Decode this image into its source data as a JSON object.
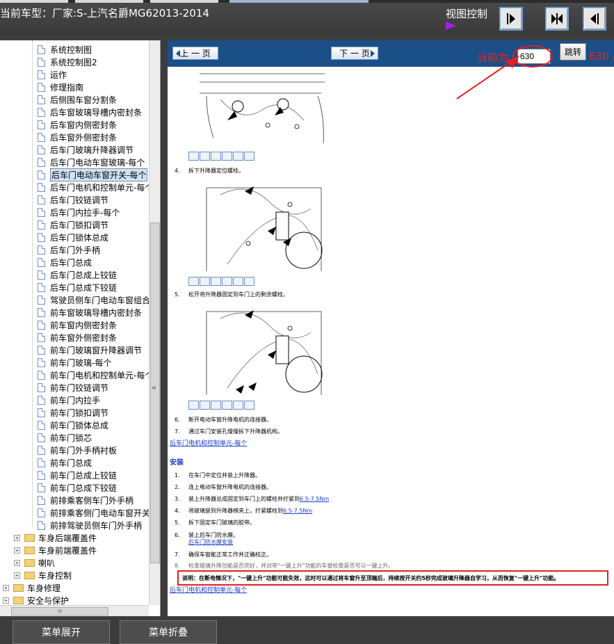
{
  "header": {
    "title": "当前车型：厂家:S-上汽名爵MG62013-2014",
    "view_control_label": "视图控制",
    "view_buttons": [
      "right-panel-toggle",
      "split-view-toggle",
      "left-panel-toggle"
    ]
  },
  "tree": {
    "items": [
      {
        "label": "系统控制图",
        "type": "doc"
      },
      {
        "label": "系统控制图2",
        "type": "doc"
      },
      {
        "label": "运作",
        "type": "doc"
      },
      {
        "label": "修理指南",
        "type": "doc"
      },
      {
        "label": "后侧围车窗分割条",
        "type": "doc"
      },
      {
        "label": "后车窗玻璃导槽内密封条",
        "type": "doc"
      },
      {
        "label": "后车窗内侧密封条",
        "type": "doc"
      },
      {
        "label": "后车窗外侧密封条",
        "type": "doc"
      },
      {
        "label": "后车门玻璃升降器调节",
        "type": "doc"
      },
      {
        "label": "后车门电动车窗玻璃-每个",
        "type": "doc"
      },
      {
        "label": "后车门电动车窗开关-每个",
        "type": "doc",
        "selected": true
      },
      {
        "label": "后车门电机和控制单元-每个",
        "type": "doc"
      },
      {
        "label": "后车门铰链调节",
        "type": "doc"
      },
      {
        "label": "后车门内拉手-每个",
        "type": "doc"
      },
      {
        "label": "后车门锁扣调节",
        "type": "doc"
      },
      {
        "label": "后车门锁体总成",
        "type": "doc"
      },
      {
        "label": "后车门外手柄",
        "type": "doc"
      },
      {
        "label": "后车门总成",
        "type": "doc"
      },
      {
        "label": "后车门总成上铰链",
        "type": "doc"
      },
      {
        "label": "后车门总成下铰链",
        "type": "doc"
      },
      {
        "label": "驾驶员侧车门电动车窗组合",
        "type": "doc"
      },
      {
        "label": "前车窗玻璃导槽内密封条",
        "type": "doc"
      },
      {
        "label": "前车窗内侧密封条",
        "type": "doc"
      },
      {
        "label": "前车窗外侧密封条",
        "type": "doc"
      },
      {
        "label": "前车门玻璃窗升降器调节",
        "type": "doc"
      },
      {
        "label": "前车门玻璃-每个",
        "type": "doc"
      },
      {
        "label": "前车门电机和控制单元-每个",
        "type": "doc"
      },
      {
        "label": "前车门铰链调节",
        "type": "doc"
      },
      {
        "label": "前车门内拉手",
        "type": "doc"
      },
      {
        "label": "前车门锁扣调节",
        "type": "doc"
      },
      {
        "label": "前车门锁体总成",
        "type": "doc"
      },
      {
        "label": "前车门锁芯",
        "type": "doc"
      },
      {
        "label": "前车门外手柄衬板",
        "type": "doc"
      },
      {
        "label": "前车门总成",
        "type": "doc"
      },
      {
        "label": "前车门总成上铰链",
        "type": "doc"
      },
      {
        "label": "前车门总成下铰链",
        "type": "doc"
      },
      {
        "label": "前排乘客侧车门外手柄",
        "type": "doc"
      },
      {
        "label": "前排乘客侧门电动车窗开关",
        "type": "doc"
      },
      {
        "label": "前排驾驶员侧车门外手柄",
        "type": "doc"
      },
      {
        "label": "车身后端覆盖件",
        "type": "folder",
        "level": 1
      },
      {
        "label": "车身前端覆盖件",
        "type": "folder",
        "level": 1
      },
      {
        "label": "喇叭",
        "type": "folder",
        "level": 1
      },
      {
        "label": "车身控制",
        "type": "folder",
        "level": 1
      },
      {
        "label": "车身修理",
        "type": "folder",
        "level": 0
      },
      {
        "label": "安全与保护",
        "type": "folder",
        "level": 0
      }
    ],
    "hscroll_grip": "III",
    "vscroll_grip": "≡"
  },
  "nav": {
    "prev_label": "上 一 页",
    "next_label": "下 一 页",
    "current_label": "当前为",
    "page_value": "630",
    "jump_label": "跳转",
    "total_text": "630 /"
  },
  "document": {
    "steps_a": [
      {
        "num": "4.",
        "text": "拆下升降器定位螺栓。"
      },
      {
        "num": "5.",
        "text": "松开将升降器固定到车门上的剩余螺栓。"
      },
      {
        "num": "6.",
        "text": "断开电动车窗升降电机的连接器。"
      },
      {
        "num": "7.",
        "text": "通过车门安装孔慢慢拆下升降器机构。"
      }
    ],
    "link_after_removal": "后车门电机和控制单元-每个",
    "install_title": "安装",
    "install_steps": [
      {
        "num": "1.",
        "text": "在车门中定位并装上升降器。",
        "link": ""
      },
      {
        "num": "2.",
        "text": "连上电动车窗升降电机的连接器。",
        "link": ""
      },
      {
        "num": "3.",
        "text": "装上升降器总成固定到车门上的螺栓并拧紧到",
        "link": "6.5-7.5Nm"
      },
      {
        "num": "4.",
        "text": "将玻璃装到升降器梯夹上，拧紧螺栓到",
        "link": "6.5-7.5Nm"
      },
      {
        "num": "5.",
        "text": "拆下固定车门玻璃的胶带。",
        "link": ""
      },
      {
        "num": "6.",
        "text": "装上后车门防水膜。",
        "link": ""
      },
      {
        "num": "7.",
        "text": "确保车窗能正常工作并正确校正。",
        "link": ""
      },
      {
        "num": "8.",
        "text": "检查玻璃升降功能是否完好，并对带\"一键上升\"功能的车窗检查是否可以一键上升。",
        "link": ""
      }
    ],
    "step6_link": "后车门防水膜安装",
    "note": "说明：在断电情况下，\"一键上升\"功能可能失效，这时可以通过将车窗升至顶端后，持续按开关约5秒完成玻璃升降器自学习，从而恢复\"一键上升\"功能。",
    "link_footer": "后车门电机和控制单元-每个",
    "highlight_color": "#e02020"
  },
  "footer": {
    "expand_label": "菜单展开",
    "collapse_label": "菜单折叠"
  }
}
